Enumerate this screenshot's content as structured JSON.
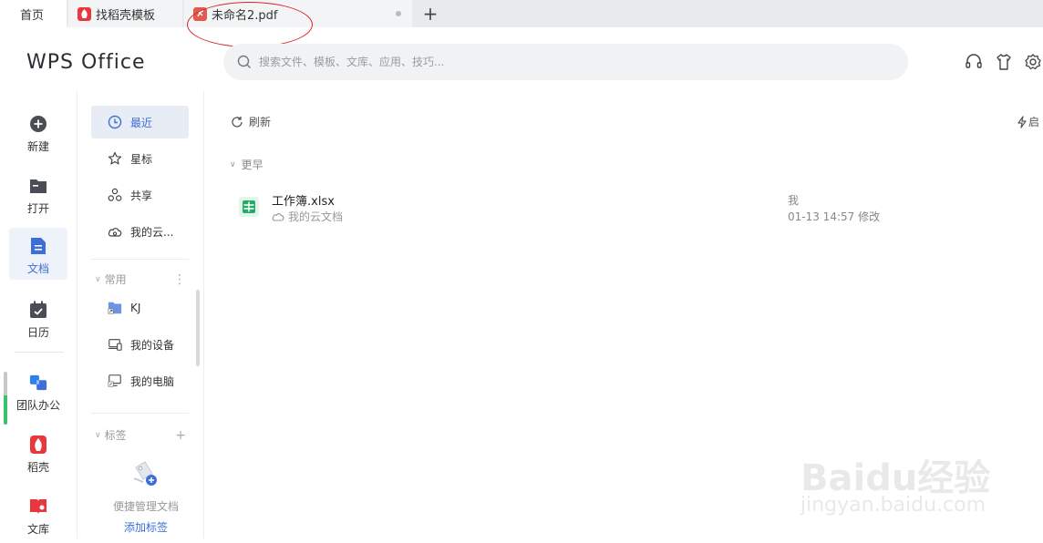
{
  "tabs": [
    {
      "label": "首页"
    },
    {
      "label": "找稻壳模板"
    },
    {
      "label": "未命名2.pdf"
    }
  ],
  "header": {
    "logo": "WPS Office",
    "search_placeholder": "搜索文件、模板、文库、应用、技巧..."
  },
  "nav": {
    "items": [
      {
        "label": "新建"
      },
      {
        "label": "打开"
      },
      {
        "label": "文档"
      },
      {
        "label": "日历"
      },
      {
        "label": "团队办公"
      },
      {
        "label": "稻壳"
      },
      {
        "label": "文库"
      }
    ]
  },
  "sub": {
    "items": [
      {
        "label": "最近"
      },
      {
        "label": "星标"
      },
      {
        "label": "共享"
      },
      {
        "label": "我的云..."
      }
    ],
    "common_header": "常用",
    "common_items": [
      {
        "label": "KJ"
      },
      {
        "label": "我的设备"
      },
      {
        "label": "我的电脑"
      }
    ],
    "tags_header": "标签",
    "tags_empty_text": "便捷管理文档",
    "tags_add_link": "添加标签"
  },
  "main": {
    "refresh_label": "刷新",
    "launch_label": "启",
    "group_label": "更早",
    "files": [
      {
        "name": "工作簿.xlsx",
        "location": "我的云文档",
        "owner": "我",
        "modified": "01-13 14:57 修改"
      }
    ]
  },
  "watermark": {
    "brand": "Baidu经验",
    "site": "jingyan.baidu.com"
  },
  "colors": {
    "accent": "#3d6fd8",
    "annotation": "#d9262c",
    "docer_red": "#e8383d",
    "sheet_green": "#2aa86a"
  }
}
